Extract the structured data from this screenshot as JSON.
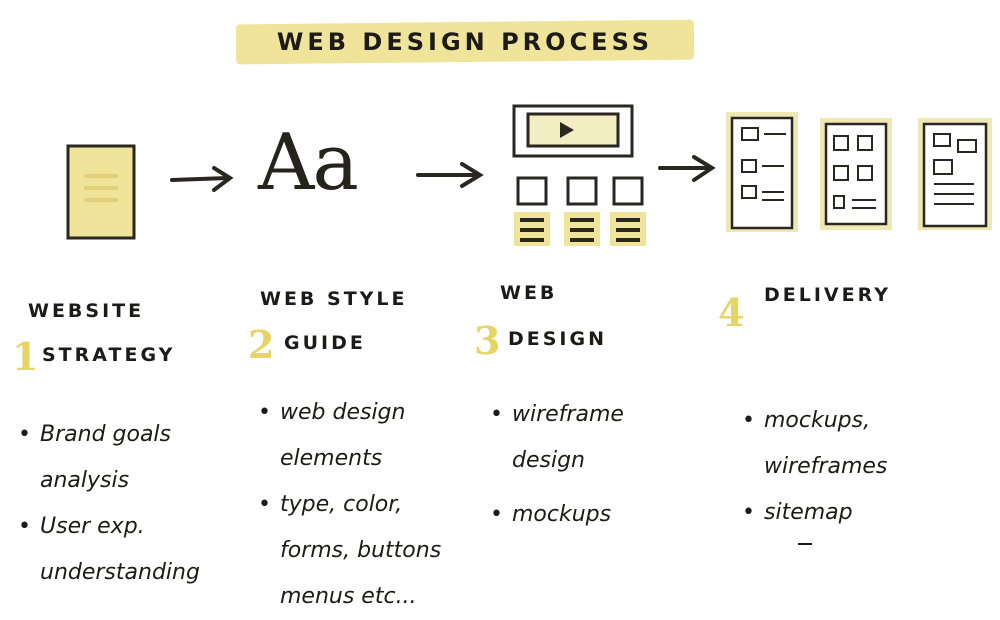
{
  "title": "WEB DESIGN PROCESS",
  "icons": {
    "style_glyph": "Aa",
    "play": "play-icon"
  },
  "colors": {
    "highlight": "#efe49a",
    "number": "#e7d466",
    "ink": "#1d1b18"
  },
  "steps": [
    {
      "number": "1",
      "heading_line1": "WEBSITE",
      "heading_line2": "STRATEGY",
      "bullets": [
        [
          "Brand goals",
          "analysis"
        ],
        [
          "User exp.",
          "understanding"
        ]
      ]
    },
    {
      "number": "2",
      "heading_line1": "WEB STYLE",
      "heading_line2": "GUIDE",
      "bullets": [
        [
          "web design",
          "elements"
        ],
        [
          "type, color,",
          "forms, buttons",
          "menus etc..."
        ]
      ]
    },
    {
      "number": "3",
      "heading_line1": "WEB",
      "heading_line2": "DESIGN",
      "bullets": [
        [
          "wireframe",
          "design"
        ],
        [
          "mockups"
        ]
      ]
    },
    {
      "number": "4",
      "heading_line1": "DELIVERY",
      "heading_line2": "",
      "bullets": [
        [
          "mockups,",
          "wireframes"
        ],
        [
          "sitemap"
        ]
      ]
    }
  ]
}
